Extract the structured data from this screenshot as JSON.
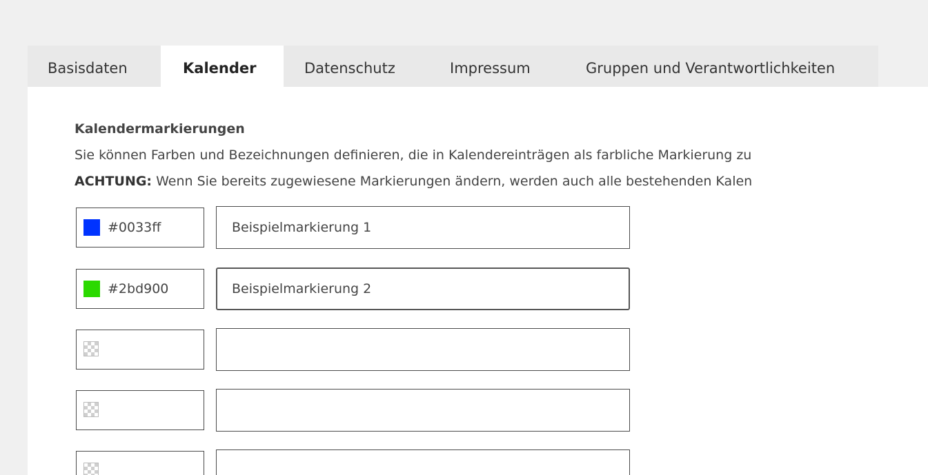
{
  "tabs": [
    {
      "label": "Basisdaten",
      "active": false
    },
    {
      "label": "Kalender",
      "active": true
    },
    {
      "label": "Datenschutz",
      "active": false
    },
    {
      "label": "Impressum",
      "active": false
    },
    {
      "label": "Gruppen und Verantwortlichkeiten",
      "active": false
    }
  ],
  "section": {
    "heading": "Kalendermarkierungen",
    "description": "Sie können Farben und Bezeichnungen definieren, die in Kalendereinträgen als farbliche Markierung zu",
    "warning_label": "ACHTUNG:",
    "warning_text": " Wenn Sie bereits zugewiesene Markierungen ändern, werden auch alle bestehenden Kalen"
  },
  "markers": [
    {
      "color": "#0033ff",
      "hex": "#0033ff",
      "name": "Beispielmarkierung 1"
    },
    {
      "color": "#2bd900",
      "hex": "#2bd900",
      "name": "Beispielmarkierung 2"
    },
    {
      "color": "",
      "hex": "",
      "name": ""
    },
    {
      "color": "",
      "hex": "",
      "name": ""
    },
    {
      "color": "",
      "hex": "",
      "name": ""
    }
  ]
}
